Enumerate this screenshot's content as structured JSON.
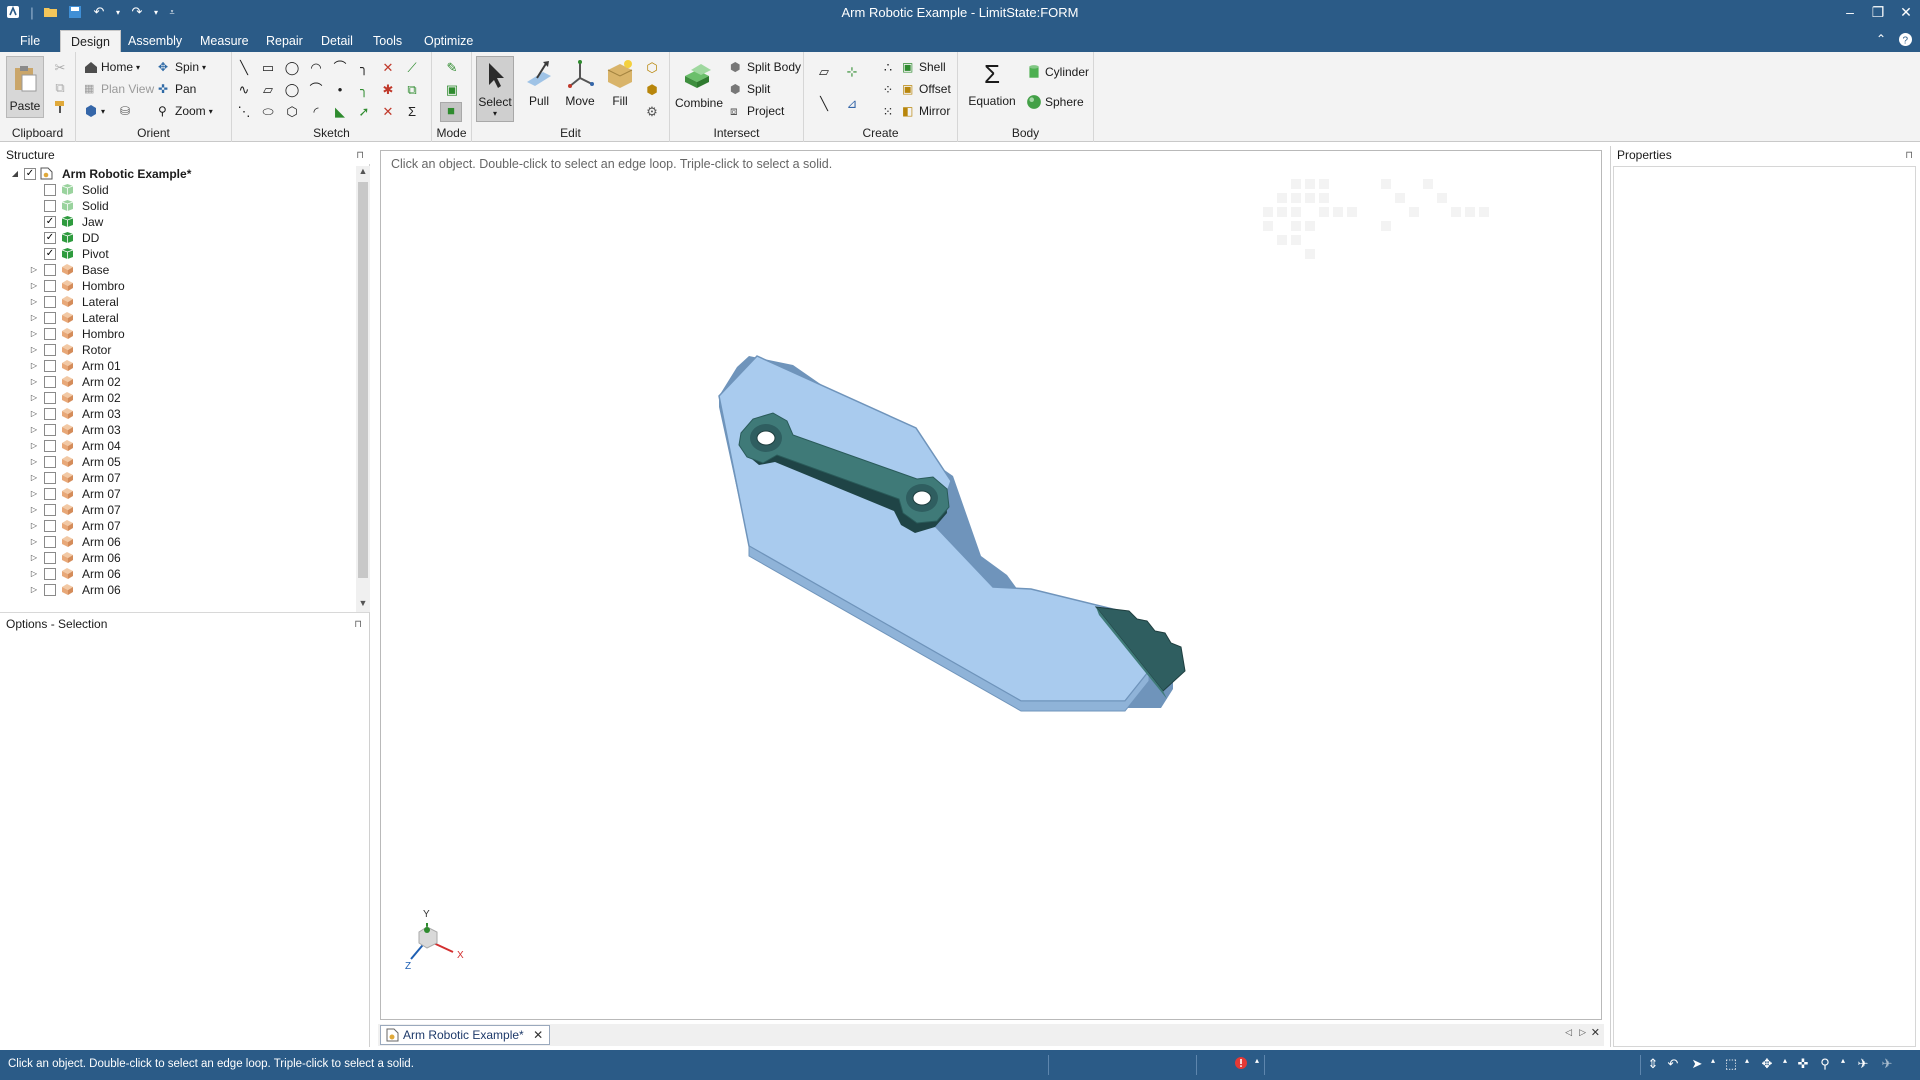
{
  "window": {
    "title": "Arm Robotic Example - LimitState:FORM"
  },
  "menu": {
    "tabs": [
      {
        "label": "File"
      },
      {
        "label": "Design"
      },
      {
        "label": "Assembly"
      },
      {
        "label": "Measure"
      },
      {
        "label": "Repair"
      },
      {
        "label": "Detail"
      },
      {
        "label": "Tools"
      },
      {
        "label": "Optimize"
      }
    ],
    "active_tab": "Design"
  },
  "ribbon": {
    "clipboard": {
      "label": "Clipboard",
      "paste": "Paste"
    },
    "orient": {
      "label": "Orient",
      "home": "Home",
      "spin": "Spin",
      "plan_view": "Plan View",
      "pan": "Pan",
      "zoom": "Zoom"
    },
    "sketch": {
      "label": "Sketch"
    },
    "mode": {
      "label": "Mode"
    },
    "edit": {
      "label": "Edit",
      "select": "Select",
      "pull": "Pull",
      "move": "Move",
      "fill": "Fill"
    },
    "intersect": {
      "label": "Intersect",
      "combine": "Combine",
      "split_body": "Split Body",
      "split": "Split",
      "project": "Project"
    },
    "create": {
      "label": "Create",
      "shell": "Shell",
      "offset": "Offset",
      "mirror": "Mirror"
    },
    "body": {
      "label": "Body",
      "equation": "Equation",
      "cylinder": "Cylinder",
      "sphere": "Sphere"
    }
  },
  "structure": {
    "title": "Structure",
    "root": "Arm Robotic Example*",
    "items": [
      {
        "label": "Solid"
      },
      {
        "label": "Solid"
      },
      {
        "label": "Jaw"
      },
      {
        "label": "DD"
      },
      {
        "label": "Pivot"
      },
      {
        "label": "Base"
      },
      {
        "label": "Hombro"
      },
      {
        "label": "Lateral"
      },
      {
        "label": "Lateral"
      },
      {
        "label": "Hombro"
      },
      {
        "label": "Rotor"
      },
      {
        "label": "Arm 01"
      },
      {
        "label": "Arm 02"
      },
      {
        "label": "Arm 02"
      },
      {
        "label": "Arm 03"
      },
      {
        "label": "Arm 03"
      },
      {
        "label": "Arm 04"
      },
      {
        "label": "Arm 05"
      },
      {
        "label": "Arm 07"
      },
      {
        "label": "Arm 07"
      },
      {
        "label": "Arm 07"
      },
      {
        "label": "Arm 07"
      },
      {
        "label": "Arm 06"
      },
      {
        "label": "Arm 06"
      },
      {
        "label": "Arm 06"
      },
      {
        "label": "Arm 06"
      }
    ]
  },
  "options": {
    "title": "Options - Selection"
  },
  "properties": {
    "title": "Properties"
  },
  "viewport": {
    "hint": "Click an object. Double-click to select an edge loop. Triple-click to select a solid.",
    "triad": {
      "x": "X",
      "y": "Y",
      "z": "Z"
    },
    "colors": {
      "plate": "#a9cbee",
      "plate_edge": "#6f94bb",
      "link": "#2f5e60",
      "link_top": "#3f7a78"
    }
  },
  "document_tab": {
    "label": "Arm Robotic Example*"
  },
  "status": {
    "message": "Click an object. Double-click to select an edge loop. Triple-click to select a solid."
  }
}
